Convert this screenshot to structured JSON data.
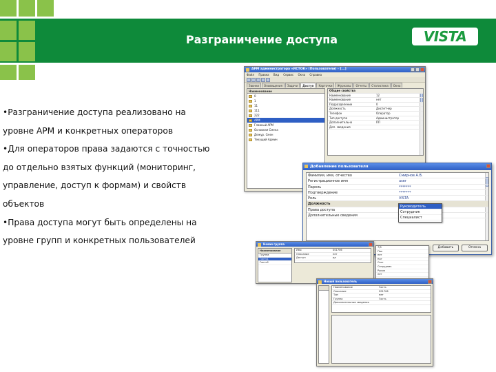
{
  "slide": {
    "title": "Разграничение доступа",
    "logo": "VISTA",
    "colors": {
      "header": "#0e8a3a",
      "accent_squares": "#8ac24a",
      "logo_text": "#1b9b3f"
    },
    "bullets": [
      [
        "•Разграничение доступа реализовано на",
        "уровне АРМ и конкретных операторов"
      ],
      [
        "•Для операторов права задаются с точностью",
        "до отдельно взятых функций (мониторинг,",
        "управление, доступ к формам) и свойств",
        "объектов"
      ],
      [
        "•Права доступа могут быть определены на",
        "уровне групп и конкретных пользователей"
      ]
    ]
  },
  "main_window": {
    "title": "АРМ администратора «ИСТОК» (Пользователи) - [...]",
    "menu": [
      "Файл",
      "Правка",
      "Вид",
      "Сервис",
      "Окна",
      "Справка"
    ],
    "tabs": [
      "Звонки",
      "Оповещения",
      "Задачи",
      "Доступ",
      "Карточки",
      "Журналы",
      "Отчеты",
      "Статистика",
      "Окна"
    ],
    "tree_header": "Наименование",
    "tree_items": [
      "0",
      "1",
      "11",
      "111",
      "222",
      "АРМ",
      "Главный АРМ",
      "Основная Смена",
      "Дежур. Смен",
      "Текущий Админ"
    ],
    "tree_selected": 5,
    "props": [
      {
        "k": "Общие свойства",
        "v": ""
      },
      {
        "k": "Наименование",
        "v": "12"
      },
      {
        "k": "Наименование",
        "v": "нет"
      },
      {
        "k": "Подразделение",
        "v": "0"
      },
      {
        "k": "Должность",
        "v": "Диспетчер"
      },
      {
        "k": "Телефон",
        "v": "Оператор"
      },
      {
        "k": "Тип доступа",
        "v": "Администратор"
      },
      {
        "k": "Дополнительно",
        "v": "ПП"
      },
      {
        "k": "Доп. сведения",
        "v": ""
      }
    ]
  },
  "add_user_dialog": {
    "title": "Добавление пользователя",
    "props": [
      {
        "k": "Фамилия, имя, отчество",
        "v": "Смирнов А.В.",
        "group": false
      },
      {
        "k": "Регистрационное имя",
        "v": "user",
        "group": false
      },
      {
        "k": "Пароль",
        "v": "*******",
        "group": false
      },
      {
        "k": "Подтверждение",
        "v": "*******",
        "group": false
      },
      {
        "k": "Роль",
        "v": "VISTA",
        "group": false
      },
      {
        "k": "Должность",
        "v": "",
        "group": true
      },
      {
        "k": "Права доступа",
        "v": "",
        "group": false
      },
      {
        "k": "Дополнительные сведения",
        "v": "",
        "group": false
      }
    ],
    "dropdown": [
      "Руководитель",
      "Сотрудник",
      "Специалист"
    ],
    "dropdown_selected": 0,
    "buttons": {
      "add": "Добавить",
      "cancel": "Отмена"
    }
  },
  "small_window_1": {
    "title": "Новая группа",
    "tabs": [
      "Свойства",
      "Состав"
    ],
    "list_header": "Наименование",
    "list": [
      "Группа",
      "Гость1",
      "Гость2"
    ],
    "props": [
      {
        "k": "Имя",
        "v": "SS1706"
      },
      {
        "k": "Описание",
        "v": "нет"
      },
      {
        "k": "Доступ",
        "v": "да"
      }
    ],
    "side_values": [
      "7/5",
      "Пол",
      "нет",
      "Кат",
      "Сост",
      "Сотрудник",
      "Руков",
      "нет"
    ]
  },
  "small_window_2": {
    "title": "Новый пользователь",
    "list_header": "Наименование",
    "props": [
      {
        "k": "Наименование",
        "v": "Гость"
      },
      {
        "k": "Описание",
        "v": "SS1706"
      },
      {
        "k": "Тип",
        "v": "нет"
      },
      {
        "k": "Группа",
        "v": "Гость"
      },
      {
        "k": "Дополнительные сведения",
        "v": ""
      }
    ]
  }
}
